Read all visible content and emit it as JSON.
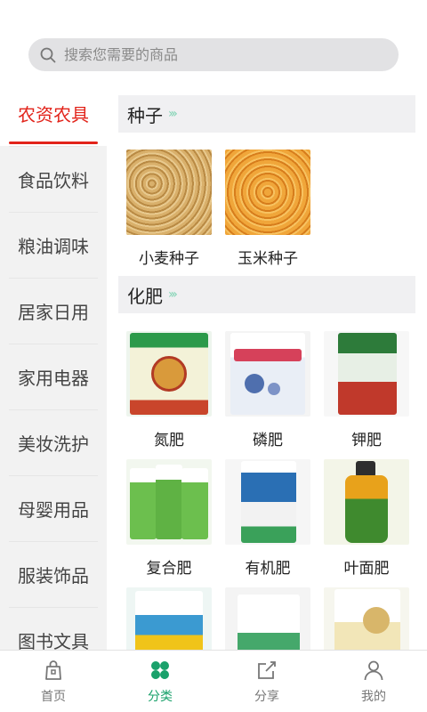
{
  "search": {
    "placeholder": "搜索您需要的商品"
  },
  "sidebar": {
    "items": [
      {
        "label": "农资农具",
        "active": true
      },
      {
        "label": "食品饮料"
      },
      {
        "label": "粮油调味"
      },
      {
        "label": "居家日用"
      },
      {
        "label": "家用电器"
      },
      {
        "label": "美妆洗护"
      },
      {
        "label": "母婴用品"
      },
      {
        "label": "服装饰品"
      },
      {
        "label": "图书文具"
      }
    ]
  },
  "categories": [
    {
      "title": "种子",
      "products": [
        {
          "name": "小麦种子"
        },
        {
          "name": "玉米种子"
        }
      ]
    },
    {
      "title": "化肥",
      "products": [
        {
          "name": "氮肥"
        },
        {
          "name": "磷肥"
        },
        {
          "name": "钾肥"
        },
        {
          "name": "复合肥"
        },
        {
          "name": "有机肥"
        },
        {
          "name": "叶面肥"
        },
        {
          "name": ""
        },
        {
          "name": ""
        },
        {
          "name": ""
        }
      ]
    }
  ],
  "bottom_nav": [
    {
      "label": "首页",
      "icon": "home-bag-icon"
    },
    {
      "label": "分类",
      "icon": "clover-icon",
      "active": true
    },
    {
      "label": "分享",
      "icon": "share-icon"
    },
    {
      "label": "我的",
      "icon": "user-icon"
    }
  ],
  "colors": {
    "accent_red": "#e2231a",
    "accent_green": "#1aa16b"
  }
}
